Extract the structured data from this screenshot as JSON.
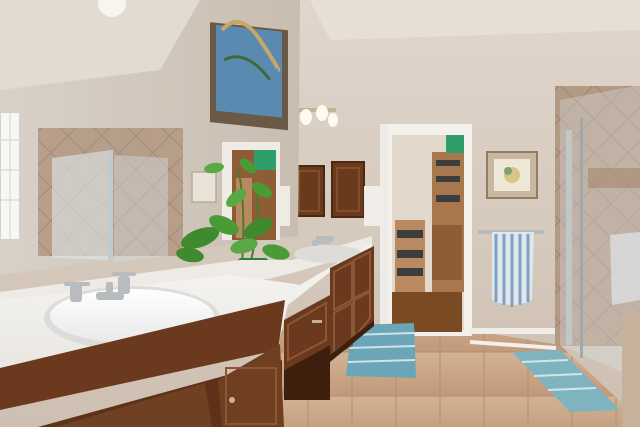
{
  "scene": {
    "subject": "bathroom",
    "objects": [
      {
        "name": "double-vanity",
        "color": "#6b3a1e"
      },
      {
        "name": "wall-mirror"
      },
      {
        "name": "potted-plant",
        "color": "#3f8a2e"
      },
      {
        "name": "walk-in-closet"
      },
      {
        "name": "glass-shower"
      },
      {
        "name": "framed-artwork"
      },
      {
        "name": "bath-towel",
        "color": "#7fa2c0"
      },
      {
        "name": "bath-rug",
        "color": "#6aa6b8"
      },
      {
        "name": "tile-floor",
        "color": "#c8a486"
      }
    ],
    "colors": {
      "wall": "#d7cabd",
      "ceiling": "#e6ddd3",
      "cabinet": "#6b3a1e",
      "counter": "#f2f0ec"
    }
  }
}
